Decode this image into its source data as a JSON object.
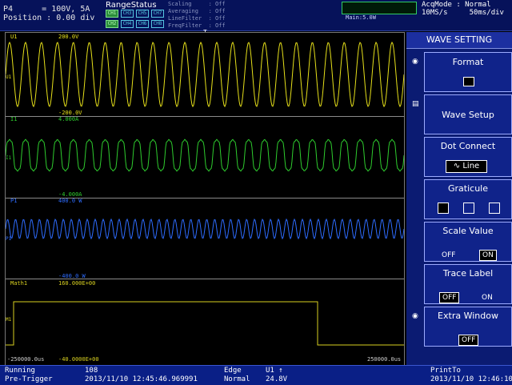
{
  "header": {
    "element": "P4",
    "range": "= 100V, 5A",
    "position_label": "Position :",
    "position_value": "0.00 div",
    "range_status_title": "RangeStatus",
    "channels": [
      "CH1",
      "CH3",
      "CH5",
      "CH7",
      "CH2",
      "CH4",
      "CH6",
      "CH8"
    ],
    "scaling": "Scaling     : Off",
    "averaging": "Averaging   : Off",
    "line_filter": "LineFilter  : Off",
    "freq_filter": "FreqFilter  : Off",
    "meter_label": "Main:5.0W",
    "acq_mode": "AcqMode : Normal",
    "sample_rate": "10MS/s",
    "timebase": "50ms/div",
    "trigger_marker": "T"
  },
  "plot": {
    "u1_name": "U1",
    "u1_top": "200.0V",
    "u1_bottom": "-200.0V",
    "i1_name": "I1",
    "i1_top": "4.000A",
    "i1_bottom": "-4.000A",
    "p1_name": "P1",
    "p1_top": "400.0 W",
    "p1_bottom": "-400.0 W",
    "math_name": "Math1",
    "math_top": "160.000E+00",
    "math_bottom": "-40.0000E+00",
    "t_left": "-250000.0us",
    "t_right": "250000.0us",
    "side_labels": [
      "U1",
      "I1",
      "P1",
      "M1"
    ]
  },
  "panel": {
    "title": "WAVE SETTING",
    "format": "Format",
    "wave_setup": "Wave Setup",
    "dot_connect": "Dot Connect",
    "dot_connect_value": "Line",
    "graticule": "Graticule",
    "scale_value": "Scale Value",
    "scale_off": "OFF",
    "scale_on": "ON",
    "trace_label": "Trace Label",
    "trace_off": "OFF",
    "trace_on": "ON",
    "extra_window": "Extra Window",
    "extra_value": "OFF"
  },
  "status": {
    "state": "Running",
    "trigger_mode_label": "Pre-Trigger",
    "count": "108",
    "timestamp1": "2013/11/10 12:45:46.969991",
    "trig_type": "Edge",
    "trig_mode": "Normal",
    "trig_source": "U1 ↑",
    "trig_level": "24.8V",
    "print_label": "PrintTo",
    "timestamp2": "2013/11/10 12:46:10"
  },
  "colors": {
    "u1": "#e6e01a",
    "i1": "#2ecc2e",
    "p1": "#2e6cff",
    "math": "#d8d020"
  }
}
